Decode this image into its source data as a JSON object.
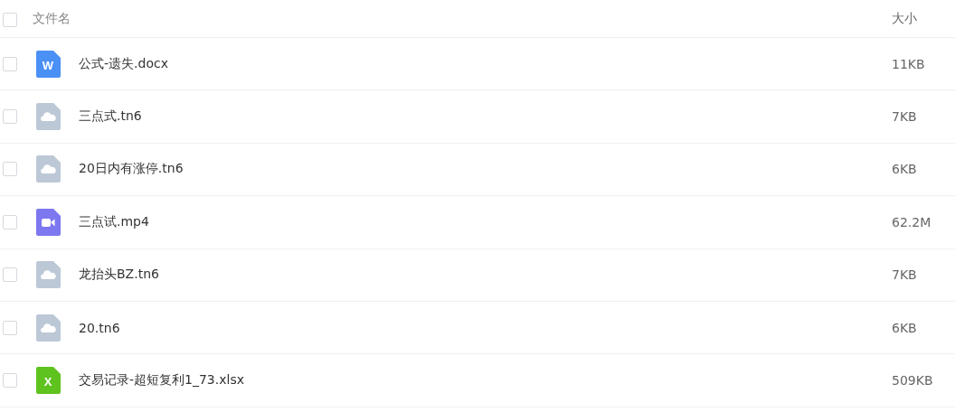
{
  "table": {
    "select_all": {
      "checked": false
    },
    "columns": [
      "文件名",
      "大小"
    ],
    "rows": [
      {
        "kind": "word",
        "icon_text": "W",
        "name": "公式-遗失.docx",
        "size": "11KB",
        "checked": false
      },
      {
        "kind": "cloud",
        "name": "三点式.tn6",
        "size": "7KB",
        "checked": false
      },
      {
        "kind": "cloud",
        "name": "20日内有涨停.tn6",
        "size": "6KB",
        "checked": false
      },
      {
        "kind": "video",
        "name": "三点试.mp4",
        "size": "62.2M",
        "checked": false
      },
      {
        "kind": "cloud",
        "name": "龙抬头BZ.tn6",
        "size": "7KB",
        "checked": false
      },
      {
        "kind": "cloud",
        "name": "20.tn6",
        "size": "6KB",
        "checked": false
      },
      {
        "kind": "excel",
        "icon_text": "X",
        "name": "交易记录-超短复利1_73.xlsx",
        "size": "509KB",
        "checked": false
      }
    ]
  }
}
